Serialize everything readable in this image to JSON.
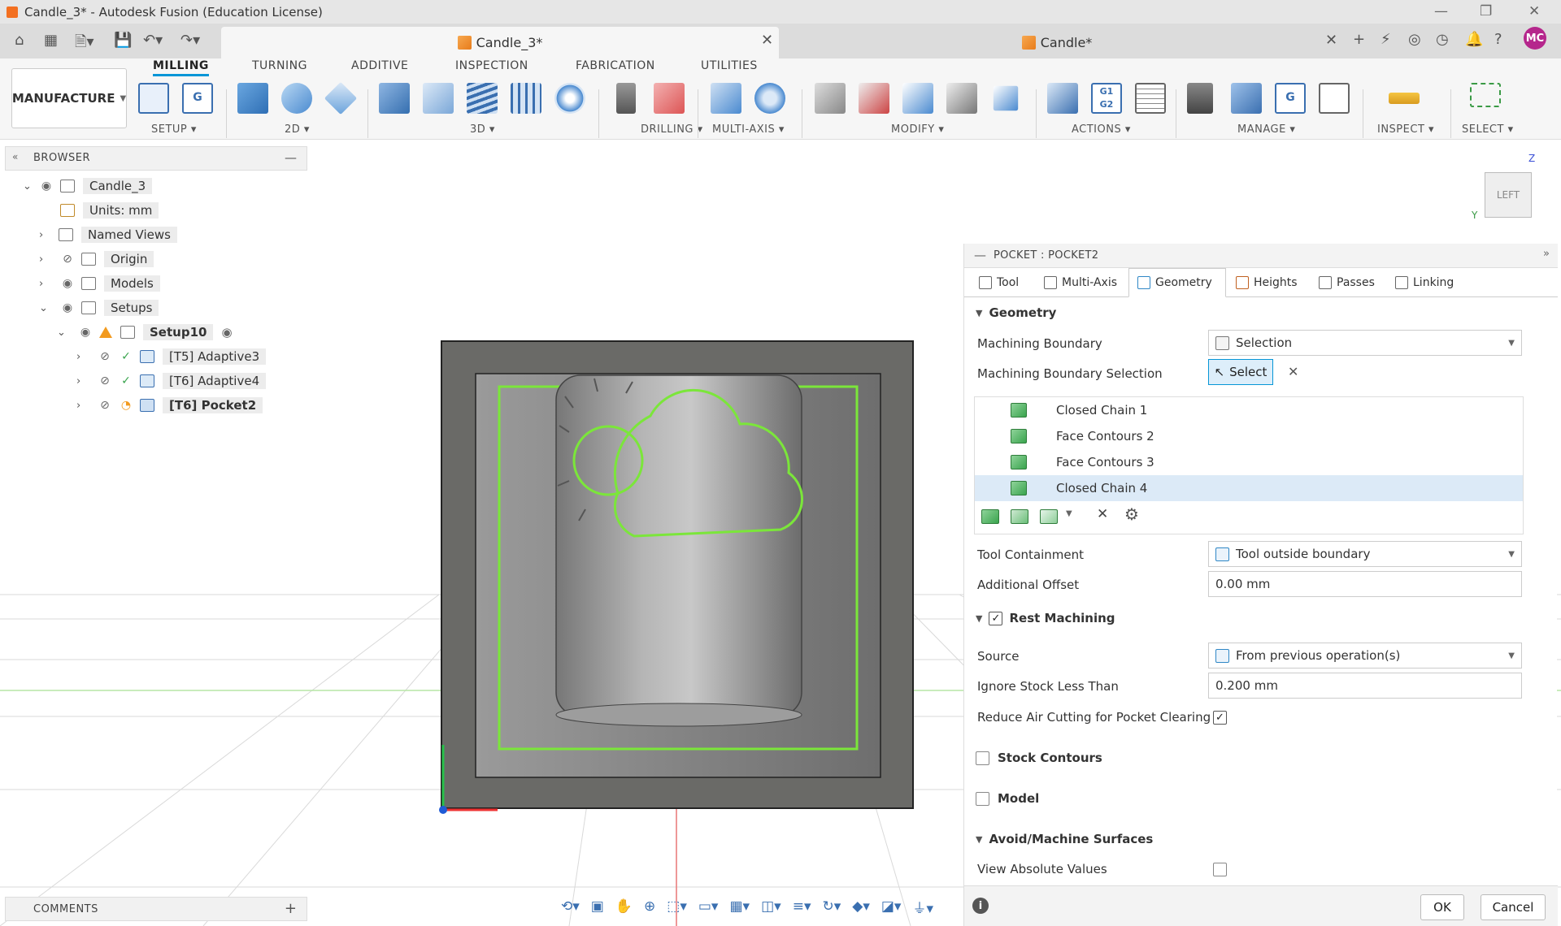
{
  "window": {
    "title": "Candle_3* - Autodesk Fusion (Education License)"
  },
  "tabs": [
    {
      "label": "Candle_3*"
    },
    {
      "label": "Candle*"
    }
  ],
  "user": {
    "initials": "MC"
  },
  "ribbon": {
    "workspace": "MANUFACTURE",
    "tabs": [
      "MILLING",
      "TURNING",
      "ADDITIVE",
      "INSPECTION",
      "FABRICATION",
      "UTILITIES"
    ],
    "groups": [
      "SETUP",
      "2D",
      "3D",
      "DRILLING",
      "MULTI-AXIS",
      "MODIFY",
      "ACTIONS",
      "MANAGE",
      "INSPECT",
      "SELECT"
    ],
    "g1g2": "G1 G2"
  },
  "browser": {
    "title": "BROWSER",
    "items": [
      {
        "label": "Candle_3"
      },
      {
        "label": "Units: mm"
      },
      {
        "label": "Named Views"
      },
      {
        "label": "Origin"
      },
      {
        "label": "Models"
      },
      {
        "label": "Setups"
      },
      {
        "label": "Setup10"
      },
      {
        "label": "[T5] Adaptive3"
      },
      {
        "label": "[T6] Adaptive4"
      },
      {
        "label": "[T6] Pocket2"
      }
    ]
  },
  "comments": {
    "title": "COMMENTS"
  },
  "viewcube": {
    "label": "LEFT",
    "axis_z": "Z",
    "axis_y": "Y"
  },
  "panel": {
    "title": "POCKET : POCKET2",
    "tabs": [
      "Tool",
      "Multi-Axis",
      "Geometry",
      "Heights",
      "Passes",
      "Linking"
    ],
    "geometry_section": "Geometry",
    "machining_boundary_label": "Machining Boundary",
    "machining_boundary_value": "Selection",
    "boundary_selection_label": "Machining Boundary Selection",
    "select_button": "Select",
    "chains": [
      "Closed Chain 1",
      "Face Contours 2",
      "Face Contours 3",
      "Closed Chain 4"
    ],
    "tool_containment_label": "Tool Containment",
    "tool_containment_value": "Tool outside boundary",
    "additional_offset_label": "Additional Offset",
    "additional_offset_value": "0.00 mm",
    "rest_machining_label": "Rest Machining",
    "source_label": "Source",
    "source_value": "From previous operation(s)",
    "ignore_stock_label": "Ignore Stock Less Than",
    "ignore_stock_value": "0.200 mm",
    "reduce_air_label": "Reduce Air Cutting for Pocket Clearing",
    "stock_contours_label": "Stock Contours",
    "model_label": "Model",
    "avoid_label": "Avoid/Machine Surfaces",
    "view_absolute_label": "View Absolute Values",
    "ok": "OK",
    "cancel": "Cancel"
  },
  "colors": {
    "accent": "#0696d7",
    "selection_green": "#7be63a",
    "avatar": "#b5268c"
  }
}
